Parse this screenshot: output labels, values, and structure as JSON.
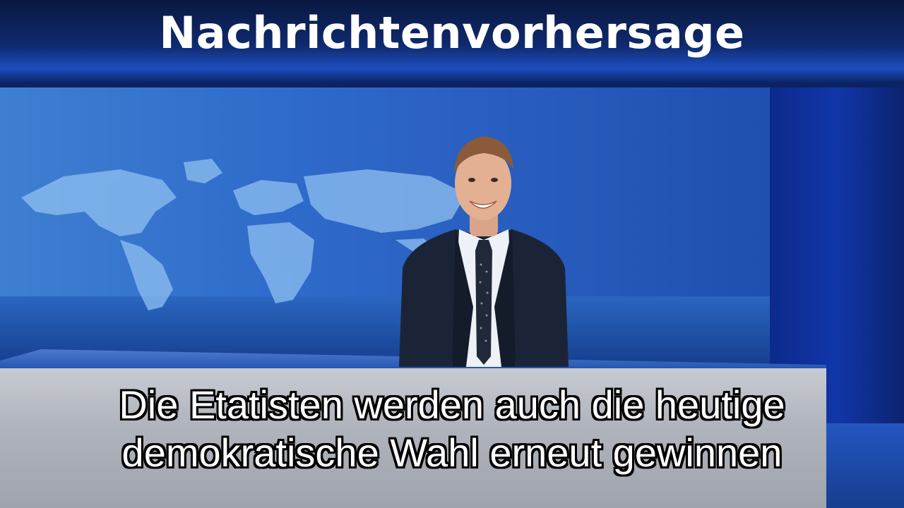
{
  "header": {
    "title": "Nachrichtenvorhersage"
  },
  "subtitle": {
    "line1": "Die Etatisten werden auch die heutige",
    "line2": "demokratische Wahl erneut gewinnen"
  },
  "colors": {
    "studio_blue": "#1140a8",
    "title_text": "#ffffff",
    "subtitle_text": "#ffffff",
    "subtitle_outline": "#000000"
  }
}
